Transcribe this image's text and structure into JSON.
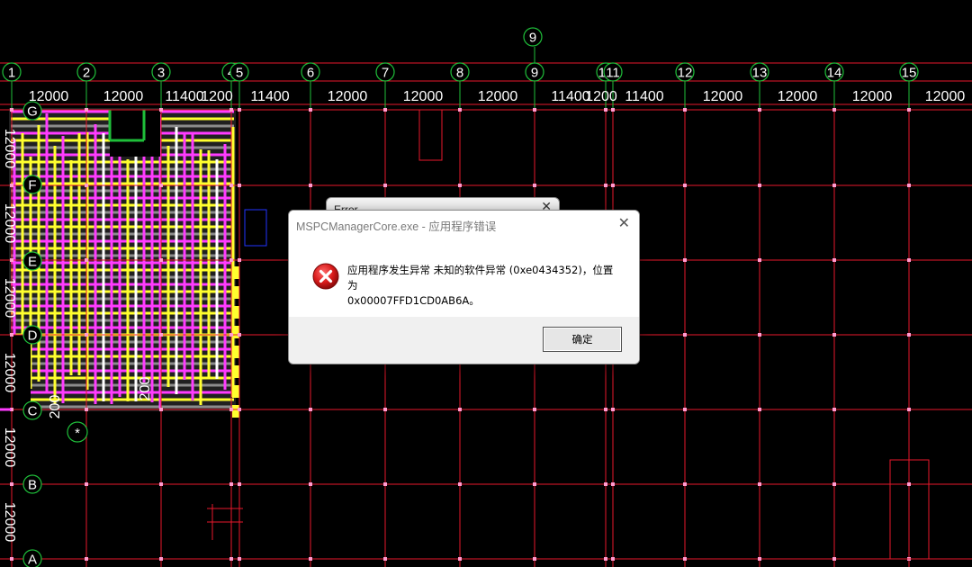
{
  "canvas": {
    "top_axes": [
      "1",
      "2",
      "3",
      "4",
      "5",
      "6",
      "7",
      "8",
      "9",
      "10",
      "11",
      "12",
      "13",
      "14",
      "15"
    ],
    "top_extra_axis": "9",
    "spacing_labels": [
      "12000",
      "12000",
      "11400",
      "1200",
      "11400",
      "12000",
      "12000",
      "12000",
      "11400",
      "1200",
      "11400",
      "12000",
      "12000",
      "12000",
      "12000"
    ],
    "left_axes": [
      "G",
      "F",
      "E",
      "D",
      "C",
      "B",
      "A"
    ],
    "left_vertical_labels": [
      "12000",
      "12000",
      "12000",
      "12000",
      "12000",
      "12000"
    ],
    "plan_labels": [
      "200",
      "200"
    ],
    "star_marker": "*"
  },
  "colors": {
    "background": "#000000",
    "grid_red": "#e8182b",
    "axis_green": "#1fbf3a",
    "beam_yellow": "#ffff2e",
    "beam_magenta": "#ff3bff",
    "beam_white": "#ffffff",
    "beam_gray": "#8c8c8c",
    "selection_blue": "#2233ff"
  },
  "dialog_back": {
    "title": "Error",
    "close_icon": "close-icon"
  },
  "dialog": {
    "title": "MSPCManagerCore.exe - 应用程序错误",
    "message_line1": "应用程序发生异常 未知的软件异常 (0xe0434352)，位置为",
    "message_line2": "0x00007FFD1CD0AB6A。",
    "ok_label": "确定",
    "icon": "error-icon",
    "close_icon": "close-icon"
  }
}
